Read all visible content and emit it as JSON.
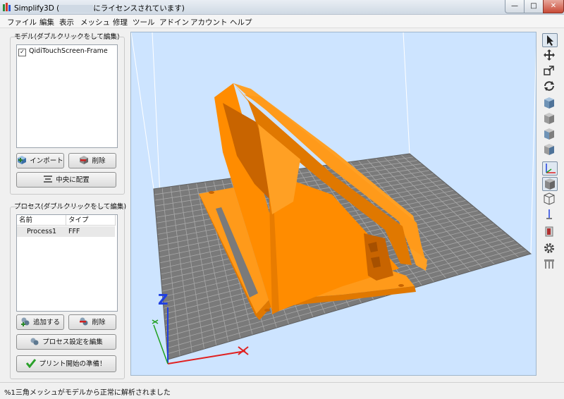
{
  "window": {
    "title_prefix": "Simplify3D (",
    "title_suffix": "にライセンスされています)",
    "min_label": "—",
    "max_label": "□",
    "close_label": "✕"
  },
  "menu": [
    "ファイル",
    "編集",
    "表示",
    "メッシュ",
    "修理",
    "ツール",
    "アドイン",
    "アカウント",
    "ヘルプ"
  ],
  "models": {
    "header": "モデル(ダブルクリックをして編集)",
    "items": [
      {
        "name": "QidiTouchScreen-Frame",
        "checked": true,
        "check_mark": "✓"
      }
    ],
    "import_label": "インポート",
    "delete_label": "削除",
    "center_label": "中央に配置"
  },
  "processes": {
    "header": "プロセス(ダブルクリックをして編集)",
    "columns": [
      "名前",
      "タイプ"
    ],
    "rows": [
      {
        "name": "Process1",
        "type": "FFF"
      }
    ],
    "add_label": "追加する",
    "delete_label": "削除",
    "edit_label": "プロセス設定を編集",
    "prepare_label": "プリント開始の準備！"
  },
  "viewport": {
    "axis_z_label": "Z",
    "colors": {
      "background": "#cde4ff",
      "bed": "#7a7a7a",
      "grid": "#a8a8a8",
      "model": "#ff8c00",
      "x_axis": "#e02020",
      "y_axis": "#20a020",
      "z_axis": "#2040e0"
    }
  },
  "toolbar": {
    "icons": [
      "select-icon",
      "move-icon",
      "scale-icon",
      "rotate-icon",
      "view-front-cube-icon",
      "view-back-cube-icon",
      "view-left-cube-icon",
      "view-right-cube-icon",
      "axes-icon",
      "solid-cube-icon",
      "wireframe-cube-icon",
      "axis-arrow-icon",
      "cross-section-icon",
      "settings-gear-icon",
      "supports-icon"
    ]
  },
  "status": {
    "message": "%1三角メッシュがモデルから正常に解析されました"
  }
}
